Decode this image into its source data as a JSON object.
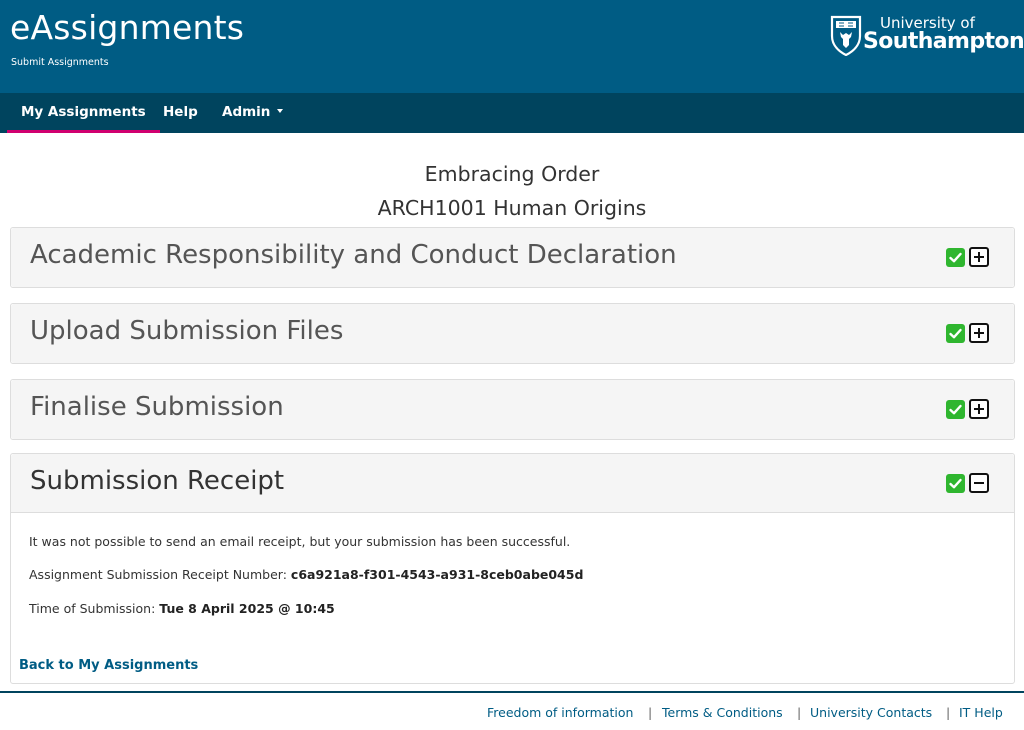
{
  "header": {
    "title": "eAssignments",
    "subtitle": "Submit Assignments",
    "logo_line1": "University of",
    "logo_line2": "Southampton"
  },
  "nav": {
    "items": [
      {
        "label": "My Assignments",
        "active": true
      },
      {
        "label": "Help",
        "active": false
      },
      {
        "label": "Admin",
        "active": false,
        "dropdown": true
      }
    ]
  },
  "assignment": {
    "name": "Embracing Order",
    "module": "ARCH1001 Human Origins"
  },
  "panels": [
    {
      "title": "Academic Responsibility and Conduct Declaration",
      "complete": true,
      "expanded": false,
      "toggle_icon": "plus-icon"
    },
    {
      "title": "Upload Submission Files",
      "complete": true,
      "expanded": false,
      "toggle_icon": "plus-icon"
    },
    {
      "title": "Finalise Submission",
      "complete": true,
      "expanded": false,
      "toggle_icon": "plus-icon"
    },
    {
      "title": "Submission Receipt",
      "complete": true,
      "expanded": true,
      "toggle_icon": "minus-icon"
    }
  ],
  "receipt": {
    "email_message": "It was not possible to send an email receipt, but your submission has been successful.",
    "receipt_number_label": "Assignment Submission Receipt Number:",
    "receipt_number": "c6a921a8-f301-4543-a931-8ceb0abe045d",
    "time_label": "Time of Submission:",
    "time_value": "Tue 8 April 2025 @ 10:45",
    "back_link": "Back to My Assignments"
  },
  "footer": {
    "links": [
      "Freedom of information",
      "Terms & Conditions",
      "University Contacts",
      "IT Help"
    ],
    "separator": "|"
  },
  "colors": {
    "header_bg": "#005c84",
    "nav_bg": "#00445e",
    "active_underline": "#d0006f",
    "complete_tick": "#2fb62f",
    "link": "#005c84"
  }
}
